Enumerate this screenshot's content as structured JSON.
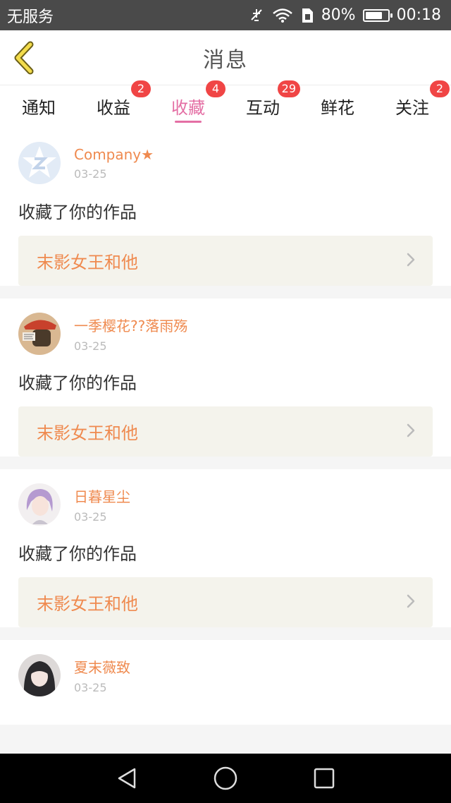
{
  "status_bar": {
    "carrier": "无服务",
    "battery_percent": "80%",
    "battery_level": 0.8,
    "time": "00:18"
  },
  "header": {
    "title": "消息"
  },
  "tabs": [
    {
      "label": "通知",
      "badge": ""
    },
    {
      "label": "收益",
      "badge": "2"
    },
    {
      "label": "收藏",
      "badge": "4",
      "active": true
    },
    {
      "label": "互动",
      "badge": "29"
    },
    {
      "label": "鲜花",
      "badge": ""
    },
    {
      "label": "关注",
      "badge": "2"
    }
  ],
  "notifications": [
    {
      "username": "Company★",
      "date": "03-25",
      "action": "收藏了你的作品",
      "work": "末影女王和他",
      "avatar": "q-logo"
    },
    {
      "username": "一季樱花??落雨殇",
      "date": "03-25",
      "action": "收藏了你的作品",
      "work": "末影女王和他",
      "avatar": "cartoon"
    },
    {
      "username": "日暮星尘",
      "date": "03-25",
      "action": "收藏了你的作品",
      "work": "末影女王和他",
      "avatar": "anime"
    },
    {
      "username": "夏末薇致",
      "date": "03-25",
      "action": "",
      "work": "",
      "avatar": "photo"
    }
  ],
  "icons": {
    "back": "chevron-left-icon",
    "work_link": "chevron-right-icon"
  },
  "colors": {
    "accent": "#e46fa4",
    "badge": "#f04545",
    "username": "#ef8a4f",
    "work_link_bg": "#f4f3ec",
    "back_arrow": "#f3dc4b"
  }
}
